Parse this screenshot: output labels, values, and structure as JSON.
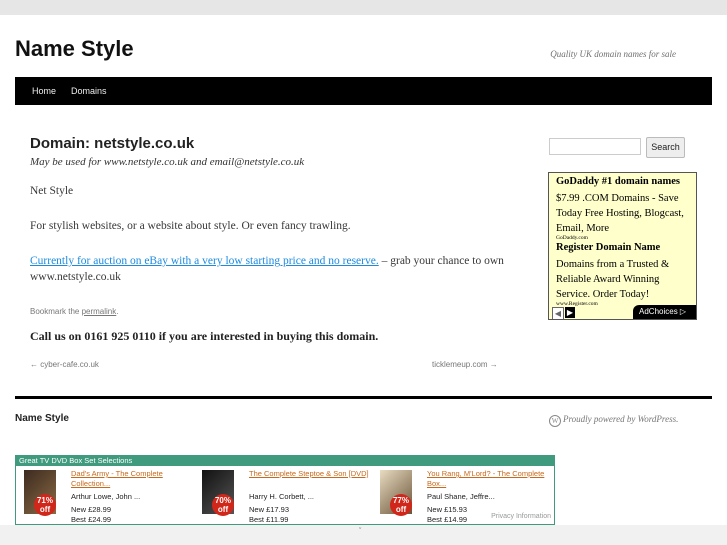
{
  "site": {
    "title": "Name Style",
    "tagline": "Quality UK domain names for sale"
  },
  "nav": [
    "Home",
    "Domains"
  ],
  "post": {
    "title": "Domain: netstyle.co.uk",
    "subtitle": "May be used for www.netstyle.co.uk and email@netstyle.co.uk",
    "p1": "Net Style",
    "p2": "For stylish websites, or a website about style. Or even fancy trawling.",
    "p3_link": "Currently for auction on eBay with a very low starting price and no reserve.",
    "p3_rest": " – grab your chance to own www.netstyle.co.uk",
    "meta_prefix": "Bookmark the ",
    "meta_link": "permalink",
    "meta_suffix": ".",
    "callout": "Call us on 0161 925 0110 if you are interested in buying this domain.",
    "prev": "← cyber-cafe.co.uk",
    "next": "ticklemeup.com →"
  },
  "sidebar": {
    "search_placeholder": "",
    "search_button": "Search",
    "ad": {
      "ad1_title": "GoDaddy #1 domain names",
      "ad1_body": "$7.99 .COM Domains - Save Today Free Hosting, Blogcast, Email, More",
      "ad1_url": "GoDaddy.com",
      "ad2_title": "Register Domain Name",
      "ad2_body": "Domains from a Trusted & Reliable Award Winning Service. Order Today!",
      "ad2_url": "www.Register.com",
      "prev_glyph": "◀",
      "next_glyph": "▶",
      "adchoices": "AdChoices ▷"
    }
  },
  "footer": {
    "title": "Name Style",
    "powered": "Proudly powered by WordPress."
  },
  "dvd_widget": {
    "header": "Great TV DVD Box Set Selections",
    "privacy": "Privacy Information",
    "items": [
      {
        "name": "Dad's Army - The Complete Collection...",
        "cast": "Arthur Lowe, John ...",
        "new": "New £28.99",
        "best": "Best £24.99",
        "badge_pct": "71%",
        "badge_off": "off"
      },
      {
        "name": "The Complete Steptoe & Son [DVD]",
        "cast": "Harry H. Corbett, ...",
        "new": "New £17.93",
        "best": "Best £11.99",
        "badge_pct": "70%",
        "badge_off": "off"
      },
      {
        "name": "You Rang, M'Lord? - The Complete Box...",
        "cast": "Paul Shane, Jeffre...",
        "new": "New £15.93",
        "best": "Best £14.99",
        "badge_pct": "77%",
        "badge_off": "off"
      }
    ]
  }
}
